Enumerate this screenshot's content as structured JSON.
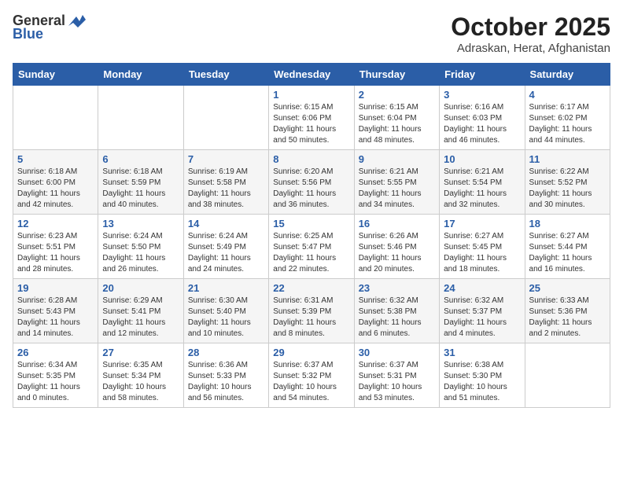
{
  "header": {
    "logo_general": "General",
    "logo_blue": "Blue",
    "month": "October 2025",
    "location": "Adraskan, Herat, Afghanistan"
  },
  "weekdays": [
    "Sunday",
    "Monday",
    "Tuesday",
    "Wednesday",
    "Thursday",
    "Friday",
    "Saturday"
  ],
  "weeks": [
    [
      {
        "day": "",
        "info": ""
      },
      {
        "day": "",
        "info": ""
      },
      {
        "day": "",
        "info": ""
      },
      {
        "day": "1",
        "info": "Sunrise: 6:15 AM\nSunset: 6:06 PM\nDaylight: 11 hours\nand 50 minutes."
      },
      {
        "day": "2",
        "info": "Sunrise: 6:15 AM\nSunset: 6:04 PM\nDaylight: 11 hours\nand 48 minutes."
      },
      {
        "day": "3",
        "info": "Sunrise: 6:16 AM\nSunset: 6:03 PM\nDaylight: 11 hours\nand 46 minutes."
      },
      {
        "day": "4",
        "info": "Sunrise: 6:17 AM\nSunset: 6:02 PM\nDaylight: 11 hours\nand 44 minutes."
      }
    ],
    [
      {
        "day": "5",
        "info": "Sunrise: 6:18 AM\nSunset: 6:00 PM\nDaylight: 11 hours\nand 42 minutes."
      },
      {
        "day": "6",
        "info": "Sunrise: 6:18 AM\nSunset: 5:59 PM\nDaylight: 11 hours\nand 40 minutes."
      },
      {
        "day": "7",
        "info": "Sunrise: 6:19 AM\nSunset: 5:58 PM\nDaylight: 11 hours\nand 38 minutes."
      },
      {
        "day": "8",
        "info": "Sunrise: 6:20 AM\nSunset: 5:56 PM\nDaylight: 11 hours\nand 36 minutes."
      },
      {
        "day": "9",
        "info": "Sunrise: 6:21 AM\nSunset: 5:55 PM\nDaylight: 11 hours\nand 34 minutes."
      },
      {
        "day": "10",
        "info": "Sunrise: 6:21 AM\nSunset: 5:54 PM\nDaylight: 11 hours\nand 32 minutes."
      },
      {
        "day": "11",
        "info": "Sunrise: 6:22 AM\nSunset: 5:52 PM\nDaylight: 11 hours\nand 30 minutes."
      }
    ],
    [
      {
        "day": "12",
        "info": "Sunrise: 6:23 AM\nSunset: 5:51 PM\nDaylight: 11 hours\nand 28 minutes."
      },
      {
        "day": "13",
        "info": "Sunrise: 6:24 AM\nSunset: 5:50 PM\nDaylight: 11 hours\nand 26 minutes."
      },
      {
        "day": "14",
        "info": "Sunrise: 6:24 AM\nSunset: 5:49 PM\nDaylight: 11 hours\nand 24 minutes."
      },
      {
        "day": "15",
        "info": "Sunrise: 6:25 AM\nSunset: 5:47 PM\nDaylight: 11 hours\nand 22 minutes."
      },
      {
        "day": "16",
        "info": "Sunrise: 6:26 AM\nSunset: 5:46 PM\nDaylight: 11 hours\nand 20 minutes."
      },
      {
        "day": "17",
        "info": "Sunrise: 6:27 AM\nSunset: 5:45 PM\nDaylight: 11 hours\nand 18 minutes."
      },
      {
        "day": "18",
        "info": "Sunrise: 6:27 AM\nSunset: 5:44 PM\nDaylight: 11 hours\nand 16 minutes."
      }
    ],
    [
      {
        "day": "19",
        "info": "Sunrise: 6:28 AM\nSunset: 5:43 PM\nDaylight: 11 hours\nand 14 minutes."
      },
      {
        "day": "20",
        "info": "Sunrise: 6:29 AM\nSunset: 5:41 PM\nDaylight: 11 hours\nand 12 minutes."
      },
      {
        "day": "21",
        "info": "Sunrise: 6:30 AM\nSunset: 5:40 PM\nDaylight: 11 hours\nand 10 minutes."
      },
      {
        "day": "22",
        "info": "Sunrise: 6:31 AM\nSunset: 5:39 PM\nDaylight: 11 hours\nand 8 minutes."
      },
      {
        "day": "23",
        "info": "Sunrise: 6:32 AM\nSunset: 5:38 PM\nDaylight: 11 hours\nand 6 minutes."
      },
      {
        "day": "24",
        "info": "Sunrise: 6:32 AM\nSunset: 5:37 PM\nDaylight: 11 hours\nand 4 minutes."
      },
      {
        "day": "25",
        "info": "Sunrise: 6:33 AM\nSunset: 5:36 PM\nDaylight: 11 hours\nand 2 minutes."
      }
    ],
    [
      {
        "day": "26",
        "info": "Sunrise: 6:34 AM\nSunset: 5:35 PM\nDaylight: 11 hours\nand 0 minutes."
      },
      {
        "day": "27",
        "info": "Sunrise: 6:35 AM\nSunset: 5:34 PM\nDaylight: 10 hours\nand 58 minutes."
      },
      {
        "day": "28",
        "info": "Sunrise: 6:36 AM\nSunset: 5:33 PM\nDaylight: 10 hours\nand 56 minutes."
      },
      {
        "day": "29",
        "info": "Sunrise: 6:37 AM\nSunset: 5:32 PM\nDaylight: 10 hours\nand 54 minutes."
      },
      {
        "day": "30",
        "info": "Sunrise: 6:37 AM\nSunset: 5:31 PM\nDaylight: 10 hours\nand 53 minutes."
      },
      {
        "day": "31",
        "info": "Sunrise: 6:38 AM\nSunset: 5:30 PM\nDaylight: 10 hours\nand 51 minutes."
      },
      {
        "day": "",
        "info": ""
      }
    ]
  ]
}
